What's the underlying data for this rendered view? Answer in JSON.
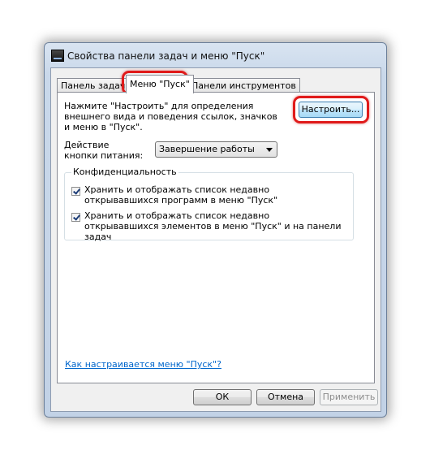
{
  "window": {
    "title": "Свойства панели задач и меню \"Пуск\""
  },
  "tabs": [
    {
      "label": "Панель задач",
      "selected": false
    },
    {
      "label": "Меню \"Пуск\"",
      "selected": true
    },
    {
      "label": "Панели инструментов",
      "selected": false
    }
  ],
  "start_menu": {
    "description": "Нажмите \"Настроить\" для определения внешнего вида и поведения ссылок, значков и меню в \"Пуск\".",
    "customize_label": "Настроить...",
    "power_label": "Действие кнопки питания:",
    "power_value": "Завершение работы",
    "privacy": {
      "legend": "Конфиденциальность",
      "options": [
        {
          "label": "Хранить и отображать список недавно открывавшихся программ в меню \"Пуск\"",
          "checked": true
        },
        {
          "label": "Хранить и отображать список недавно открывавшихся элементов в меню \"Пуск\" и на панели задач",
          "checked": true
        }
      ]
    },
    "help_link": "Как настраивается меню \"Пуск\"?"
  },
  "buttons": {
    "ok": "ОК",
    "cancel": "Отмена",
    "apply": "Применить"
  },
  "colors": {
    "highlight": "#e01b1b",
    "link": "#0066cc"
  }
}
